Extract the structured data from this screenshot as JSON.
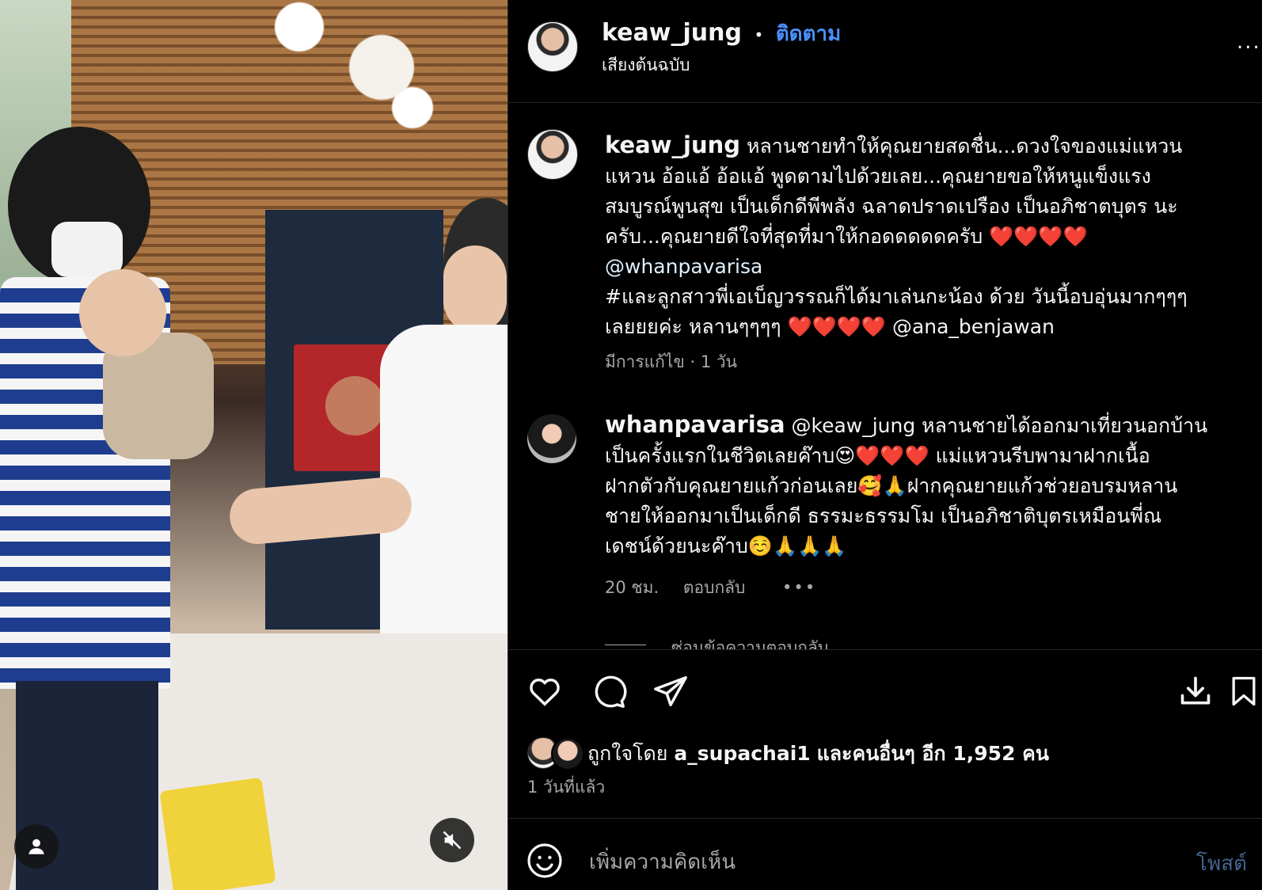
{
  "post": {
    "username": "keaw_jung",
    "separator": "•",
    "follow_label": "ติดตาม",
    "audio_label": "เสียงต้นฉบับ",
    "more_label": "..."
  },
  "caption": {
    "username": "keaw_jung",
    "lines": [
      "หลานชายทำให้คุณยายสดชื่น...ดวงใจของแม่แหวน",
      "แหวน อ้อแอ้ อ้อแอ้ พูดตามไปด้วยเลย...คุณยายขอให้หนูแข็งแรง",
      "สมบูรณ์พูนสุข เป็นเด็กดีพีพลัง ฉลาดปราดเปรือง เป็นอภิชาตบุตร นะ",
      "ครับ...คุณยายดีใจที่สุดที่มาให้กอดดดดดครับ ❤️❤️❤️❤️",
      "@whanpavarisa",
      "#และลูกสาวพี่เอเบ็ญวรรณก็ได้มาเล่นกะน้อง ด้วย วันนี้อบอุ่นมากๆๆๆ",
      "เลยยยค่ะ หลานๆๆๆๆ ❤️❤️❤️❤️ @ana_benjawan"
    ],
    "meta": "มีการแก้ไข · 1 วัน"
  },
  "comment": {
    "username": "whanpavarisa",
    "lines": [
      "@keaw_jung หลานชายได้ออกมาเที่ยวนอกบ้าน",
      "เป็นครั้งแรกในชีวิตเลยค๊าบ😍❤️❤️❤️ แม่แหวนรีบพามาฝากเนื้อ",
      "ฝากตัวกับคุณยายแก้วก่อนเลย🥰🙏ฝากคุณยายแก้วช่วยอบรมหลาน",
      "ชายให้ออกมาเป็นเด็กดี ธรรมะธรรมโม เป็นอภิชาติบุตรเหมือนพี่ณ",
      "เดชน์ด้วยนะค๊าบ☺️🙏🙏🙏"
    ],
    "time": "20 ชม.",
    "reply_label": "ตอบกลับ",
    "more_label": "•••",
    "hide_replies": "ซ่อนข้อความตอบกลับ"
  },
  "likes": {
    "prefix": "ถูกใจโดย",
    "user": "a_supachai1",
    "suffix": "และคนอื่นๆ อีก 1,952 คน",
    "posted": "1 วันที่แล้ว"
  },
  "composer": {
    "placeholder": "เพิ่มความคิดเห็น",
    "post_label": "โพสต์"
  },
  "icons": {
    "like": "heart-icon",
    "comment": "comment-icon",
    "share": "send-icon",
    "download": "download-icon",
    "save": "bookmark-icon",
    "emoji": "emoji-icon",
    "mute": "mute-icon",
    "tagged": "person-icon"
  },
  "colors": {
    "accent": "#4c90ff",
    "background": "#000000",
    "muted_text": "#a8a8a8"
  }
}
